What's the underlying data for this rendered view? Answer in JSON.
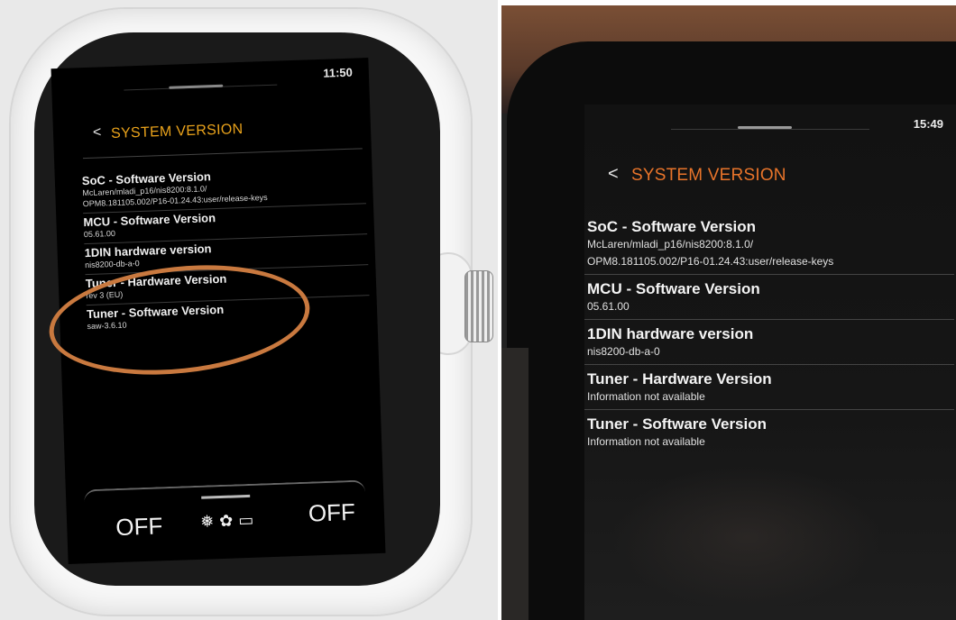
{
  "left": {
    "clock": "11:50",
    "back_glyph": "<",
    "title": "SYSTEM VERSION",
    "items": [
      {
        "heading": "SoC - Software Version",
        "value": "McLaren/mladi_p16/nis8200:8.1.0/\nOPM8.181105.002/P16-01.24.43:user/release-keys"
      },
      {
        "heading": "MCU - Software Version",
        "value": "05.61.00"
      },
      {
        "heading": "1DIN hardware version",
        "value": "nis8200-db-a-0"
      },
      {
        "heading": "Tuner - Hardware Version",
        "value": "rev 3 (EU)"
      },
      {
        "heading": "Tuner - Software Version",
        "value": "saw-3.6.10"
      }
    ],
    "climate": {
      "left": "OFF",
      "right": "OFF",
      "icons": "❅✿▭"
    }
  },
  "right": {
    "clock": "15:49",
    "back_glyph": "<",
    "title": "SYSTEM VERSION",
    "items": [
      {
        "heading": "SoC - Software Version",
        "value": "McLaren/mladi_p16/nis8200:8.1.0/\nOPM8.181105.002/P16-01.24.43:user/release-keys"
      },
      {
        "heading": "MCU - Software Version",
        "value": "05.61.00"
      },
      {
        "heading": "1DIN hardware version",
        "value": "nis8200-db-a-0"
      },
      {
        "heading": "Tuner - Hardware Version",
        "value": "Information not available"
      },
      {
        "heading": "Tuner - Software Version",
        "value": "Information not available"
      }
    ]
  },
  "colors": {
    "title_left": "#e9a21b",
    "title_right": "#e8742a",
    "annotation": "#c9793f"
  }
}
